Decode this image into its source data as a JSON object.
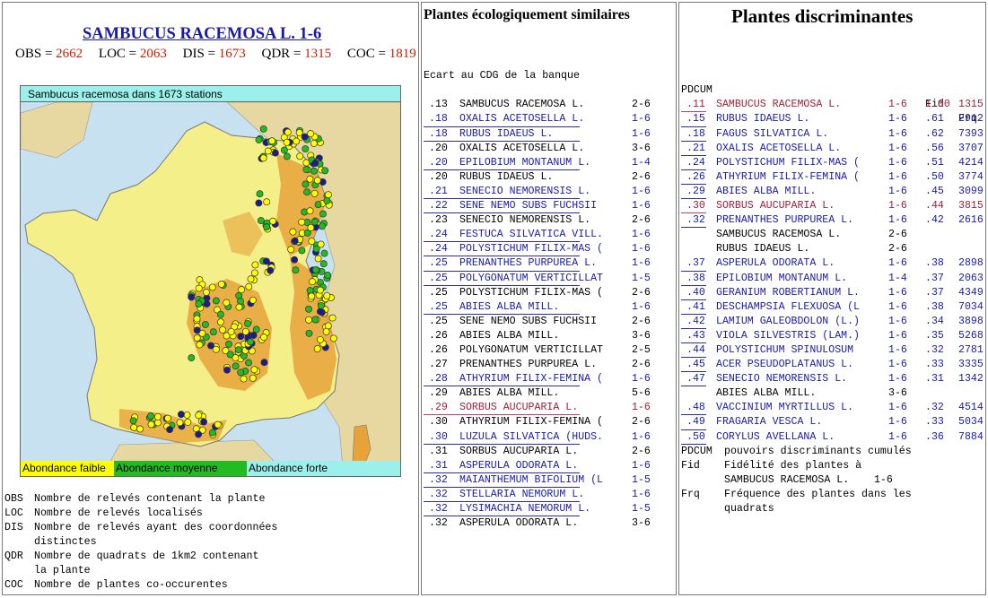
{
  "left": {
    "title": "SAMBUCUS RACEMOSA L. 1-6",
    "stats": [
      {
        "key": "OBS",
        "value": "2662"
      },
      {
        "key": "LOC",
        "value": "2063"
      },
      {
        "key": "DIS",
        "value": "1673"
      },
      {
        "key": "QDR",
        "value": "1315"
      },
      {
        "key": "COC",
        "value": "1819"
      }
    ],
    "map_caption": "Sambucus racemosa dans 1673 stations",
    "legend": [
      "Abondance faible",
      "Abondance moyenne",
      "Abondance forte"
    ],
    "definitions": [
      {
        "key": "OBS",
        "text": "Nombre de relevés contenant la plante"
      },
      {
        "key": "LOC",
        "text": "Nombre de relevés localisés"
      },
      {
        "key": "DIS",
        "text": "Nombre de relevés ayant des coordonnées"
      },
      {
        "key": "",
        "text": "distinctes"
      },
      {
        "key": "QDR",
        "text": "Nombre de quadrats de 1km2 contenant"
      },
      {
        "key": "",
        "text": "la plante"
      },
      {
        "key": "COC",
        "text": "Nombre de plantes co-occurentes"
      }
    ]
  },
  "middle": {
    "title": "Plantes écologiquement similaires",
    "subtitle": "Ecart au CDG de la banque",
    "rows": [
      {
        "ecart": ".13",
        "name": "SAMBUCUS RACEMOSA L.",
        "range": "2-6",
        "style": "plain"
      },
      {
        "ecart": ".18",
        "name": "OXALIS ACETOSELLA L.",
        "range": "1-6",
        "style": "link"
      },
      {
        "ecart": ".18",
        "name": "RUBUS IDAEUS L.",
        "range": "1-6",
        "style": "link"
      },
      {
        "ecart": ".20",
        "name": "OXALIS ACETOSELLA L.",
        "range": "3-6",
        "style": "plain"
      },
      {
        "ecart": ".20",
        "name": "EPILOBIUM MONTANUM L.",
        "range": "1-4",
        "style": "link"
      },
      {
        "ecart": ".20",
        "name": "RUBUS IDAEUS L.",
        "range": "2-6",
        "style": "plain"
      },
      {
        "ecart": ".21",
        "name": "SENECIO NEMORENSIS L.",
        "range": "1-6",
        "style": "link"
      },
      {
        "ecart": ".22",
        "name": "SENE NEMO SUBS FUCHSII",
        "range": "1-6",
        "style": "link"
      },
      {
        "ecart": ".23",
        "name": "SENECIO NEMORENSIS L.",
        "range": "2-6",
        "style": "plain"
      },
      {
        "ecart": ".24",
        "name": "FESTUCA SILVATICA VILL.",
        "range": "1-6",
        "style": "link"
      },
      {
        "ecart": ".24",
        "name": "POLYSTICHUM FILIX-MAS (",
        "range": "1-6",
        "style": "link"
      },
      {
        "ecart": ".25",
        "name": "PRENANTHES PURPUREA L.",
        "range": "1-6",
        "style": "link"
      },
      {
        "ecart": ".25",
        "name": "POLYGONATUM VERTICILLAT",
        "range": "1-5",
        "style": "link"
      },
      {
        "ecart": ".25",
        "name": "POLYSTICHUM FILIX-MAS (",
        "range": "2-6",
        "style": "plain"
      },
      {
        "ecart": ".25",
        "name": "ABIES ALBA MILL.",
        "range": "1-6",
        "style": "link"
      },
      {
        "ecart": ".25",
        "name": "SENE NEMO SUBS FUCHSII",
        "range": "2-6",
        "style": "plain"
      },
      {
        "ecart": ".26",
        "name": "ABIES ALBA MILL.",
        "range": "3-6",
        "style": "plain"
      },
      {
        "ecart": ".26",
        "name": "POLYGONATUM VERTICILLAT",
        "range": "2-5",
        "style": "plain"
      },
      {
        "ecart": ".27",
        "name": "PRENANTHES PURPUREA L.",
        "range": "2-6",
        "style": "plain"
      },
      {
        "ecart": ".28",
        "name": "ATHYRIUM FILIX-FEMINA (",
        "range": "1-6",
        "style": "link"
      },
      {
        "ecart": ".29",
        "name": "ABIES ALBA MILL.",
        "range": "5-6",
        "style": "plain"
      },
      {
        "ecart": ".29",
        "name": "SORBUS AUCUPARIA L.",
        "range": "1-6",
        "style": "pink"
      },
      {
        "ecart": ".30",
        "name": "ATHYRIUM FILIX-FEMINA (",
        "range": "2-6",
        "style": "plain"
      },
      {
        "ecart": ".30",
        "name": "LUZULA SILVATICA (HUDS.",
        "range": "1-6",
        "style": "link"
      },
      {
        "ecart": ".31",
        "name": "SORBUS AUCUPARIA L.",
        "range": "2-6",
        "style": "plain"
      },
      {
        "ecart": ".31",
        "name": "ASPERULA ODORATA L.",
        "range": "1-6",
        "style": "link"
      },
      {
        "ecart": ".32",
        "name": "MAIANTHEMUM BIFOLIUM (L",
        "range": "1-5",
        "style": "link"
      },
      {
        "ecart": ".32",
        "name": "STELLARIA NEMORUM L.",
        "range": "1-6",
        "style": "link"
      },
      {
        "ecart": ".32",
        "name": "LYSIMACHIA NEMORUM L.",
        "range": "1-5",
        "style": "link"
      },
      {
        "ecart": ".32",
        "name": "ASPERULA ODORATA L.",
        "range": "3-6",
        "style": "plain"
      }
    ]
  },
  "right": {
    "title": "Plantes discriminantes",
    "header": {
      "pdcum": "PDCUM",
      "fid": "Fid",
      "frq": "Frq"
    },
    "rows": [
      {
        "pdcum": ".11",
        "name": "SAMBUCUS RACEMOSA L.",
        "range": "1-6",
        "fid": "1.00",
        "frq": "1315",
        "style": "pink"
      },
      {
        "pdcum": ".15",
        "name": "RUBUS IDAEUS L.",
        "range": "1-6",
        "fid": ".61",
        "frq": "2912",
        "style": "link"
      },
      {
        "pdcum": ".18",
        "name": "FAGUS SILVATICA L.",
        "range": "1-6",
        "fid": ".62",
        "frq": "7393",
        "style": "link"
      },
      {
        "pdcum": ".21",
        "name": "OXALIS ACETOSELLA L.",
        "range": "1-6",
        "fid": ".56",
        "frq": "3707",
        "style": "link"
      },
      {
        "pdcum": ".24",
        "name": "POLYSTICHUM FILIX-MAS (",
        "range": "1-6",
        "fid": ".51",
        "frq": "4214",
        "style": "link"
      },
      {
        "pdcum": ".26",
        "name": "ATHYRIUM FILIX-FEMINA (",
        "range": "1-6",
        "fid": ".50",
        "frq": "3774",
        "style": "link"
      },
      {
        "pdcum": ".29",
        "name": "ABIES ALBA MILL.",
        "range": "1-6",
        "fid": ".45",
        "frq": "3099",
        "style": "link"
      },
      {
        "pdcum": ".30",
        "name": "SORBUS AUCUPARIA L.",
        "range": "1-6",
        "fid": ".44",
        "frq": "3815",
        "style": "pink"
      },
      {
        "pdcum": ".32",
        "name": "PRENANTHES PURPUREA L.",
        "range": "1-6",
        "fid": ".42",
        "frq": "2616",
        "style": "link"
      },
      {
        "pdcum": "",
        "name": "SAMBUCUS RACEMOSA L.",
        "range": "2-6",
        "fid": "",
        "frq": "",
        "style": "plain"
      },
      {
        "pdcum": "",
        "name": "RUBUS IDAEUS L.",
        "range": "2-6",
        "fid": "",
        "frq": "",
        "style": "plain"
      },
      {
        "pdcum": ".37",
        "name": "ASPERULA ODORATA L.",
        "range": "1-6",
        "fid": ".38",
        "frq": "2898",
        "style": "link"
      },
      {
        "pdcum": ".38",
        "name": "EPILOBIUM MONTANUM L.",
        "range": "1-4",
        "fid": ".37",
        "frq": "2063",
        "style": "link"
      },
      {
        "pdcum": ".40",
        "name": "GERANIUM ROBERTIANUM L.",
        "range": "1-6",
        "fid": ".37",
        "frq": "4349",
        "style": "link"
      },
      {
        "pdcum": ".41",
        "name": "DESCHAMPSIA FLEXUOSA (L",
        "range": "1-6",
        "fid": ".38",
        "frq": "7034",
        "style": "link"
      },
      {
        "pdcum": ".42",
        "name": "LAMIUM GALEOBDOLON (L.)",
        "range": "1-6",
        "fid": ".34",
        "frq": "3898",
        "style": "link"
      },
      {
        "pdcum": ".43",
        "name": "VIOLA SILVESTRIS (LAM.)",
        "range": "1-6",
        "fid": ".35",
        "frq": "5268",
        "style": "link"
      },
      {
        "pdcum": ".44",
        "name": "POLYSTICHUM SPINULOSUM",
        "range": "1-6",
        "fid": ".32",
        "frq": "2781",
        "style": "link"
      },
      {
        "pdcum": ".45",
        "name": "ACER PSEUDOPLATANUS L.",
        "range": "1-6",
        "fid": ".33",
        "frq": "3335",
        "style": "link"
      },
      {
        "pdcum": ".47",
        "name": "SENECIO NEMORENSIS L.",
        "range": "1-6",
        "fid": ".31",
        "frq": "1342",
        "style": "link"
      },
      {
        "pdcum": "",
        "name": "ABIES ALBA MILL.",
        "range": "3-6",
        "fid": "",
        "frq": "",
        "style": "plain"
      },
      {
        "pdcum": ".48",
        "name": "VACCINIUM MYRTILLUS L.",
        "range": "1-6",
        "fid": ".32",
        "frq": "4514",
        "style": "link"
      },
      {
        "pdcum": ".49",
        "name": "FRAGARIA VESCA L.",
        "range": "1-6",
        "fid": ".33",
        "frq": "5034",
        "style": "link"
      },
      {
        "pdcum": ".50",
        "name": "CORYLUS AVELLANA L.",
        "range": "1-6",
        "fid": ".36",
        "frq": "7884",
        "style": "link"
      }
    ],
    "footnotes": [
      {
        "key": "PDCUM",
        "text": "pouvoirs discriminants cumulés"
      },
      {
        "key": "Fid",
        "text": "Fidélité des plantes à"
      },
      {
        "key": "",
        "text": "SAMBUCUS RACEMOSA L.    1-6"
      },
      {
        "key": "Frq",
        "text": "Fréquence des plantes dans les"
      },
      {
        "key": "",
        "text": "quadrats"
      }
    ]
  },
  "colors": {
    "link": "#1a1aa8",
    "link_pink": "#a0203a",
    "value_red": "#c02000",
    "map_sea": "#c8e1f1",
    "map_land": "#f5ef8a",
    "map_relief": "#e8a23a",
    "dot_yellow": "#ffff00",
    "dot_green": "#22bb22",
    "dot_blue": "#1c1c90",
    "legend_bar": "#9cf0ec"
  }
}
